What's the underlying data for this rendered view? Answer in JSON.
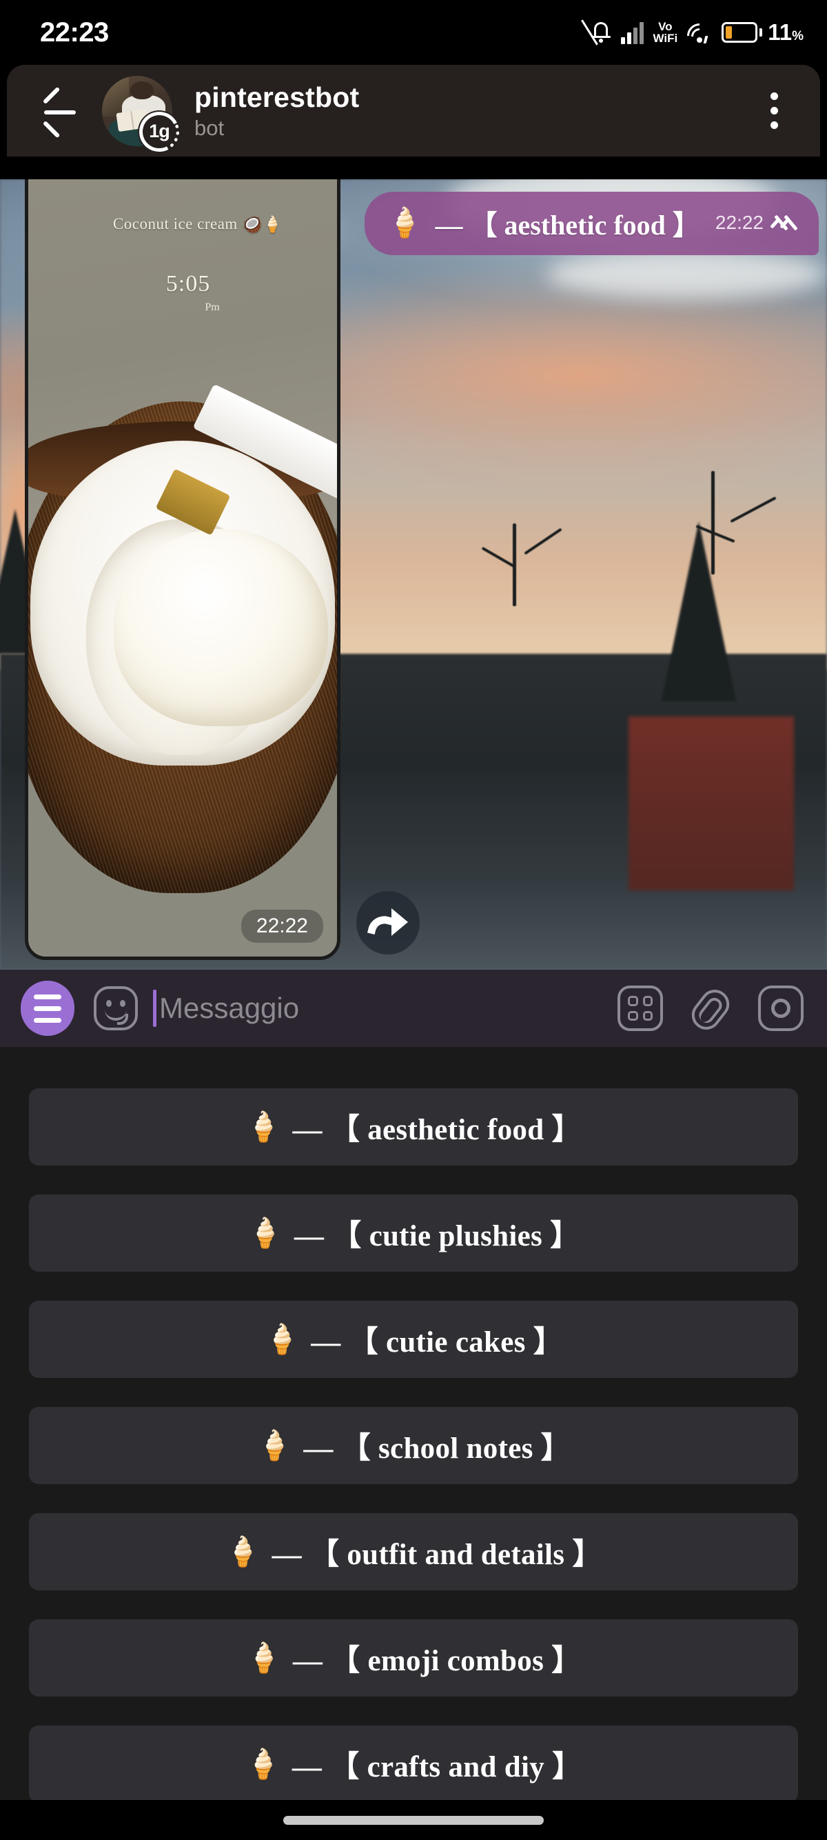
{
  "status_bar": {
    "time": "22:23",
    "battery_percent": "11",
    "percent_symbol": "%",
    "network_label": "Vo",
    "network_label2": "WiFi",
    "icons": [
      "mute-bell-icon",
      "signal-bars-icon",
      "vowifi-icon",
      "wifi-icon",
      "battery-icon"
    ]
  },
  "header": {
    "title": "pinterestbot",
    "subtitle": "bot",
    "story_badge": "1g",
    "back_icon": "back-arrow-icon",
    "menu_icon": "more-vertical-icon"
  },
  "messages": {
    "outgoing_text": {
      "emoji": "🍦",
      "text": "— 【 aesthetic food 】",
      "time": "22:22",
      "status": "read-double-check"
    },
    "photo": {
      "caption": "Coconut ice cream",
      "caption_emoji": "🥥🍦",
      "overlay_time": "5:05",
      "overlay_ampm": "Pm",
      "time": "22:22",
      "forward_icon": "forward-arrow-icon"
    }
  },
  "input_bar": {
    "menu_icon": "hamburger-menu-icon",
    "sticker_icon": "sticker-smiley-icon",
    "placeholder": "Messaggio",
    "value": "",
    "grid_icon": "bot-commands-grid-icon",
    "attach_icon": "paperclip-icon",
    "camera_icon": "camera-icon"
  },
  "bot_keyboard": {
    "buttons": [
      {
        "emoji": "🍦",
        "label": "— 【 aesthetic food 】"
      },
      {
        "emoji": "🍦",
        "label": "— 【 cutie plushies 】"
      },
      {
        "emoji": "🍦",
        "label": "— 【 cutie cakes 】"
      },
      {
        "emoji": "🍦",
        "label": "— 【 school notes 】"
      },
      {
        "emoji": "🍦",
        "label": "— 【 outfit and details 】"
      },
      {
        "emoji": "🍦",
        "label": "— 【 emoji combos 】"
      },
      {
        "emoji": "🍦",
        "label": "— 【 crafts and diy 】"
      }
    ]
  },
  "nav_bar": {
    "gesture_pill": "home-indicator"
  },
  "colors": {
    "accent_purple": "#9a6fd4",
    "bubble_purple": "#8d4d8d",
    "header_bg": "#26211f",
    "input_bg": "#2b2530",
    "keyboard_bg": "#1a1a1a",
    "button_bg": "#302f33",
    "battery_orange": "#f0a32a"
  }
}
